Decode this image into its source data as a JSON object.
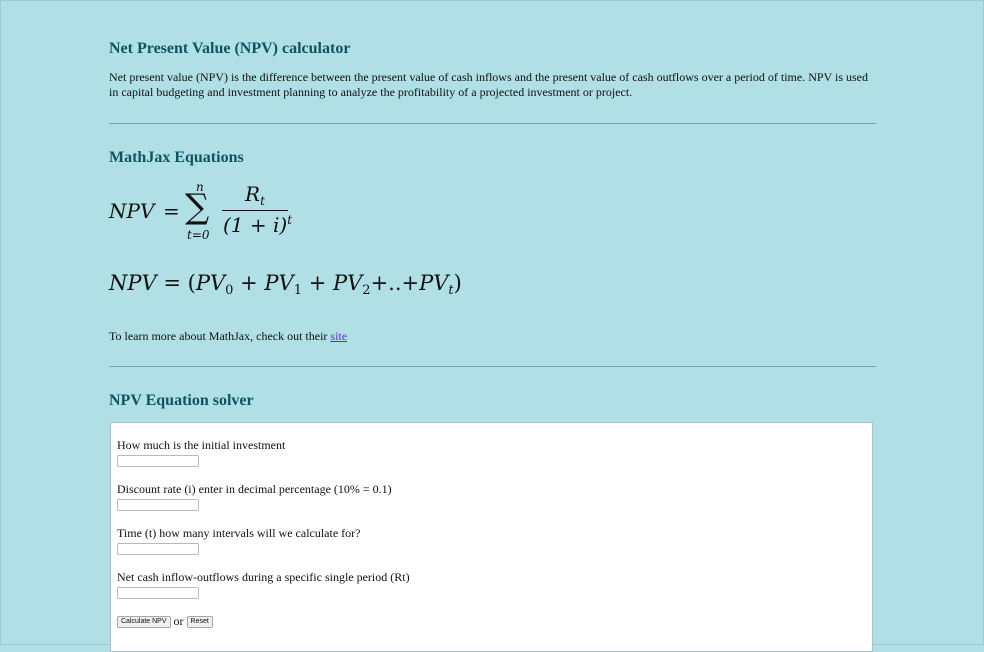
{
  "header": {
    "title": "Net Present Value (NPV) calculator",
    "intro": "Net present value (NPV) is the difference between the present value of cash inflows and the present value of cash outflows over a period of time. NPV is used in capital budgeting and investment planning to analyze the profitability of a projected investment or project."
  },
  "mathjax": {
    "heading": "MathJax Equations",
    "eq1": {
      "lhs": "NPV",
      "equals": "=",
      "sum_symbol": "∑",
      "sum_upper": "n",
      "sum_lower": "t=0",
      "numerator_base": "R",
      "numerator_sub": "t",
      "denominator": "(1 + i)",
      "denominator_sup": "t"
    },
    "eq2": {
      "lhs": "NPV",
      "equals": "=",
      "open": "(",
      "term0": "PV",
      "sub0": "0",
      "plus1": "+",
      "term1": "PV",
      "sub1": "1",
      "plus2": "+",
      "term2": "PV",
      "sub2": "2",
      "dots": "+..+",
      "term3": "PV",
      "sub3": "t",
      "close": ")"
    },
    "learn_more_text": "To learn more about MathJax, check out their ",
    "learn_more_link": "site"
  },
  "solver": {
    "heading": "NPV Equation solver",
    "fields": [
      {
        "label": "How much is the initial investment",
        "value": ""
      },
      {
        "label": "Discount rate (i) enter in decimal percentage (10% = 0.1)",
        "value": ""
      },
      {
        "label": "Time (t) how many intervals will we calculate for?",
        "value": ""
      },
      {
        "label": "Net cash inflow-outflows during a specific single period (Rt)",
        "value": ""
      }
    ],
    "calculate_label": "Calculate NPV",
    "or_text": "or",
    "reset_label": "Reset"
  }
}
